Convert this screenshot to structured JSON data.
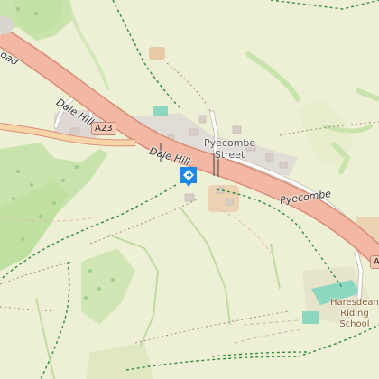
{
  "labels": {
    "dale_hill_a": "Dale Hill",
    "dale_hill_b": "Dale Hill",
    "road_partial": "oad",
    "pyecombe": "Pyecombe",
    "pyecombe_street_1": "Pyecombe",
    "pyecombe_street_2": "Street",
    "haresdean_1": "Haresdean",
    "haresdean_2": "Riding",
    "haresdean_3": "School"
  },
  "shields": {
    "a23": "A23",
    "a_partial": "A"
  },
  "poi": {
    "icon": "route-direction-icon"
  },
  "colors": {
    "background": "#eef0d5",
    "wood": "#c9e3ad",
    "trunk_road": "#f2b8a3",
    "trunk_casing": "#d98c77",
    "minor_road": "#ffffff",
    "path": "#2e8b3a",
    "poi": "#1e88e5",
    "sport": "#8dd6c0"
  }
}
